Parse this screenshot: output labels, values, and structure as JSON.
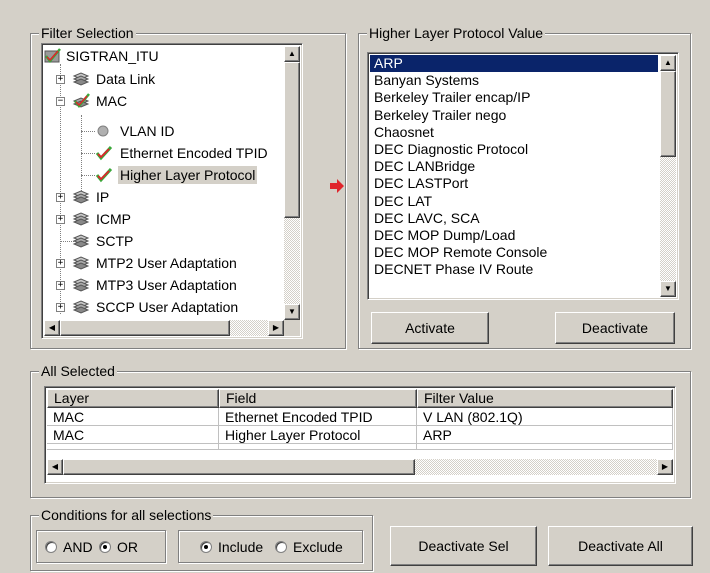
{
  "filter_selection": {
    "title": "Filter Selection",
    "tree": [
      {
        "label": "SIGTRAN_ITU",
        "icon": "checked-network-icon"
      },
      {
        "label": "Data Link",
        "icon": "protocol-icon",
        "expander": "+"
      },
      {
        "label": "MAC",
        "icon": "checked-protocol-icon",
        "expander": "−"
      },
      {
        "label": "VLAN ID",
        "icon": "field-bullet-icon"
      },
      {
        "label": "Ethernet Encoded TPID",
        "icon": "checkmark-icon"
      },
      {
        "label": "Higher Layer Protocol",
        "icon": "checkmark-icon"
      },
      {
        "label": "IP",
        "icon": "protocol-icon",
        "expander": "+"
      },
      {
        "label": "ICMP",
        "icon": "protocol-icon",
        "expander": "+"
      },
      {
        "label": "SCTP",
        "icon": "protocol-icon"
      },
      {
        "label": "MTP2 User Adaptation",
        "icon": "protocol-icon",
        "expander": "+"
      },
      {
        "label": "MTP3 User Adaptation",
        "icon": "protocol-icon",
        "expander": "+"
      },
      {
        "label": "SCCP User Adaptation",
        "icon": "protocol-icon",
        "expander": "+"
      }
    ]
  },
  "arrow_icon": "red-arrow-right-icon",
  "higher_layer": {
    "title": "Higher Layer Protocol Value",
    "items": [
      "ARP",
      "Banyan Systems",
      "Berkeley Trailer encap/IP",
      "Berkeley Trailer nego",
      "Chaosnet",
      "DEC Diagnostic Protocol",
      "DEC LANBridge",
      "DEC LASTPort",
      "DEC LAT",
      "DEC LAVC, SCA",
      "DEC MOP Dump/Load",
      "DEC MOP Remote Console",
      "DECNET Phase IV Route"
    ],
    "selected": "ARP",
    "activate_label": "Activate",
    "deactivate_label": "Deactivate"
  },
  "all_selected": {
    "title": "All Selected",
    "columns": [
      "Layer",
      "Field",
      "Filter Value"
    ],
    "rows": [
      [
        "MAC",
        "Ethernet Encoded TPID",
        "V LAN (802.1Q)"
      ],
      [
        "MAC",
        "Higher Layer Protocol",
        "ARP"
      ]
    ]
  },
  "conditions": {
    "title": "Conditions for all selections",
    "and_label": "AND",
    "or_label": "OR",
    "include_label": "Include",
    "exclude_label": "Exclude",
    "logic_selected": "OR",
    "mode_selected": "Include"
  },
  "buttons": {
    "deactivate_sel": "Deactivate Sel",
    "deactivate_all": "Deactivate All"
  },
  "colors": {
    "window_bg": "#d4d0c8",
    "selection": "#0a246a",
    "check_red": "#e0242b",
    "check_green": "#3aa83a"
  }
}
